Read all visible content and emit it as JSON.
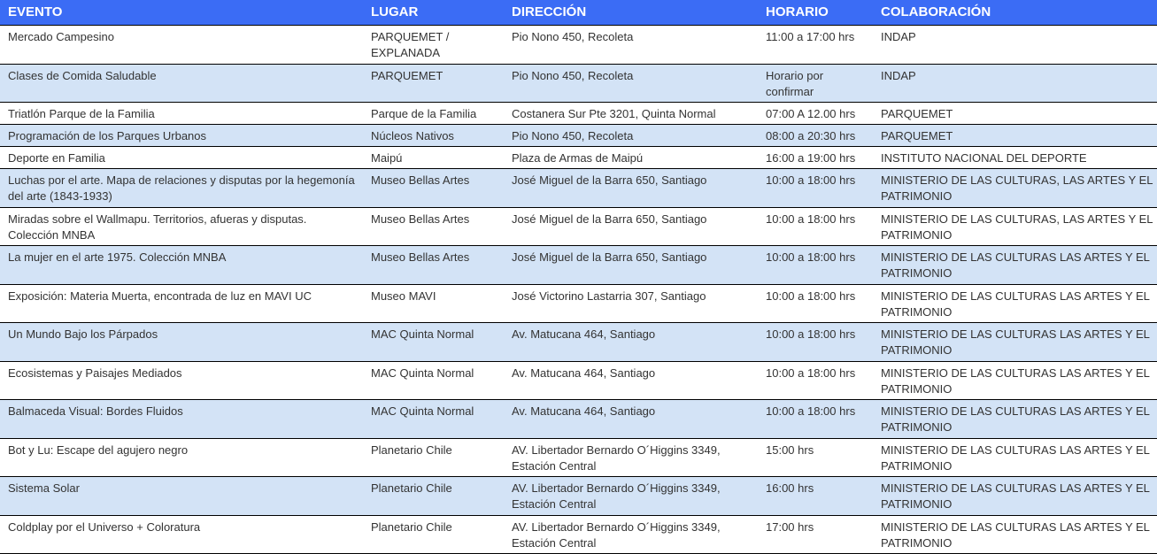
{
  "colors": {
    "header_bg": "#3b6cf5",
    "header_text": "#ffffff",
    "alt_row_bg": "#d3e3f6"
  },
  "table": {
    "headers": [
      "EVENTO",
      "LUGAR",
      "DIRECCIÓN",
      "HORARIO",
      "COLABORACIÓN"
    ],
    "rows": [
      [
        "Mercado Campesino",
        "PARQUEMET / EXPLANADA",
        "Pio Nono 450, Recoleta",
        "11:00 a 17:00 hrs",
        "INDAP"
      ],
      [
        "Clases de Comida Saludable",
        "PARQUEMET",
        "Pio Nono 450, Recoleta",
        "Horario por confirmar",
        "INDAP"
      ],
      [
        "Triatlón Parque de la Familia",
        "Parque de la Familia",
        "Costanera Sur Pte 3201, Quinta Normal",
        "07:00 A 12.00 hrs",
        "PARQUEMET"
      ],
      [
        "Programación de los Parques Urbanos",
        "Núcleos Nativos",
        "Pio Nono 450, Recoleta",
        "08:00 a 20:30 hrs",
        "PARQUEMET"
      ],
      [
        "Deporte en Familia",
        "Maipú",
        "Plaza de Armas de Maipú",
        "16:00 a 19:00 hrs",
        "INSTITUTO NACIONAL DEL DEPORTE"
      ],
      [
        "Luchas por el arte. Mapa de relaciones y disputas por la hegemonía del arte (1843-1933)",
        "Museo Bellas Artes",
        "José Miguel de la Barra 650, Santiago",
        "10:00 a 18:00 hrs",
        "MINISTERIO DE LAS CULTURAS, LAS ARTES Y EL PATRIMONIO"
      ],
      [
        "Miradas sobre el Wallmapu. Territorios, afueras y disputas. Colección MNBA",
        "Museo Bellas Artes",
        "José Miguel de la Barra 650, Santiago",
        "10:00 a 18:00 hrs",
        "MINISTERIO DE LAS CULTURAS, LAS ARTES Y EL PATRIMONIO"
      ],
      [
        "La mujer en el arte 1975. Colección MNBA",
        "Museo Bellas Artes",
        "José Miguel de la Barra 650, Santiago",
        "10:00 a 18:00 hrs",
        "MINISTERIO DE LAS CULTURAS LAS ARTES Y EL PATRIMONIO"
      ],
      [
        "Exposición: Materia Muerta, encontrada de luz en MAVI UC",
        "Museo MAVI",
        "José Victorino Lastarria 307, Santiago",
        "10:00 a 18:00 hrs",
        "MINISTERIO DE LAS CULTURAS LAS ARTES Y EL PATRIMONIO"
      ],
      [
        "Un Mundo Bajo los Párpados",
        "MAC Quinta Normal",
        "Av. Matucana 464, Santiago",
        "10:00 a 18:00 hrs",
        "MINISTERIO DE LAS CULTURAS LAS ARTES Y EL PATRIMONIO"
      ],
      [
        "Ecosistemas y Paisajes Mediados",
        "MAC Quinta Normal",
        "Av. Matucana 464, Santiago",
        "10:00 a 18:00 hrs",
        "MINISTERIO DE LAS CULTURAS LAS ARTES Y EL PATRIMONIO"
      ],
      [
        "Balmaceda Visual: Bordes Fluidos",
        "MAC Quinta Normal",
        "Av. Matucana 464, Santiago",
        "10:00 a 18:00 hrs",
        "MINISTERIO DE LAS CULTURAS LAS ARTES Y EL PATRIMONIO"
      ],
      [
        "Bot y Lu: Escape del agujero negro",
        "Planetario Chile",
        "AV. Libertador Bernardo O´Higgins 3349, Estación Central",
        "15:00 hrs",
        "MINISTERIO DE LAS CULTURAS LAS ARTES Y EL PATRIMONIO"
      ],
      [
        "Sistema Solar",
        "Planetario Chile",
        "AV. Libertador Bernardo O´Higgins 3349, Estación Central",
        "16:00 hrs",
        "MINISTERIO DE LAS CULTURAS LAS ARTES Y EL PATRIMONIO"
      ],
      [
        "Coldplay por el Universo + Coloratura",
        "Planetario Chile",
        "AV. Libertador Bernardo O´Higgins 3349, Estación Central",
        "17:00 hrs",
        "MINISTERIO DE LAS CULTURAS LAS ARTES Y EL PATRIMONIO"
      ]
    ]
  }
}
